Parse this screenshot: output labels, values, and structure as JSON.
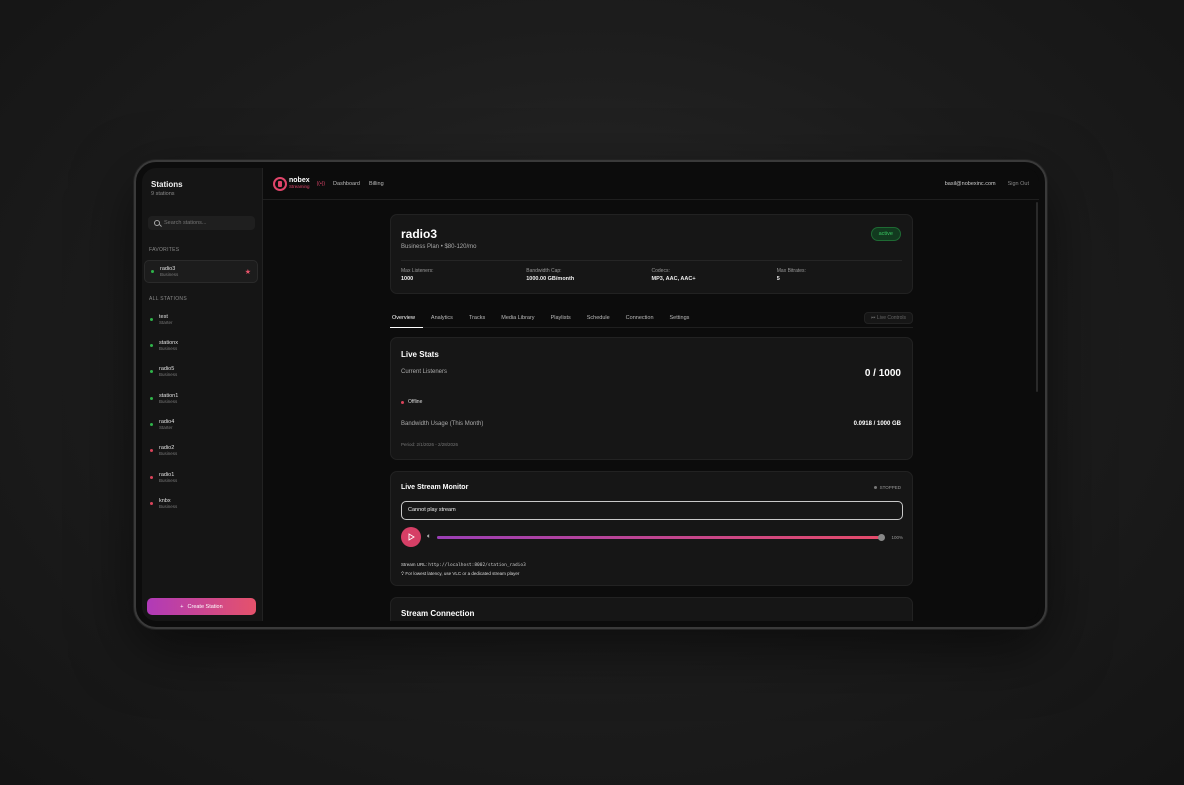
{
  "sidebar": {
    "title": "Stations",
    "count": "9 stations",
    "search_placeholder": "Search stations...",
    "favorites_label": "FAVORITES",
    "all_label": "ALL STATIONS",
    "favorites": [
      {
        "name": "radio3",
        "plan": "Business",
        "status": "green"
      }
    ],
    "stations": [
      {
        "name": "test",
        "plan": "Starter",
        "status": "green"
      },
      {
        "name": "stationx",
        "plan": "Business",
        "status": "green"
      },
      {
        "name": "radio5",
        "plan": "Business",
        "status": "green"
      },
      {
        "name": "station1",
        "plan": "Business",
        "status": "green"
      },
      {
        "name": "radio4",
        "plan": "Starter",
        "status": "green"
      },
      {
        "name": "radio2",
        "plan": "Business",
        "status": "red"
      },
      {
        "name": "radio1",
        "plan": "Business",
        "status": "red"
      },
      {
        "name": "knbx",
        "plan": "Business",
        "status": "red"
      }
    ],
    "create_label": "Create Station",
    "create_icon": "+"
  },
  "topbar": {
    "brand": "nobex",
    "brand_sub": "Streaming",
    "nav": [
      "Dashboard",
      "Billing"
    ],
    "user_email": "basil@nobexinc.com",
    "sign_out": "Sign Out"
  },
  "station": {
    "name": "radio3",
    "plan": "Business Plan • $80-120/mo",
    "status": "active",
    "specs": [
      {
        "label": "Max Listeners:",
        "value": "1000"
      },
      {
        "label": "Bandwidth Cap:",
        "value": "1000.00 GB/month"
      },
      {
        "label": "Codecs:",
        "value": "MP3, AAC, AAC+"
      },
      {
        "label": "Max Bitrates:",
        "value": "5"
      }
    ]
  },
  "tabs": [
    "Overview",
    "Analytics",
    "Tracks",
    "Media Library",
    "Playlists",
    "Schedule",
    "Connection",
    "Settings"
  ],
  "live_controls": "Live Controls",
  "live_stats": {
    "title": "Live Stats",
    "listeners_label": "Current Listeners",
    "listeners_value": "0 / 1000",
    "state": "Offline",
    "bandwidth_label": "Bandwidth Usage (This Month)",
    "bandwidth_value": "0.0918 / 1000 GB",
    "period": "Period: 2/1/2026 - 2/28/2026"
  },
  "monitor": {
    "title": "Live Stream Monitor",
    "state": "STOPPED",
    "error": "Cannot play stream",
    "volume_fraction": 1.0,
    "volume_label": "100%",
    "url_label": "Stream URL:",
    "url": "http://localhost:8002/station_radio3",
    "tip": "For lowest latency, use VLC or a dedicated stream player"
  },
  "connection": {
    "title": "Stream Connection"
  },
  "colors": {
    "accent": "#e0456a",
    "active_green": "#39c561",
    "offline_red": "#d9435a"
  }
}
